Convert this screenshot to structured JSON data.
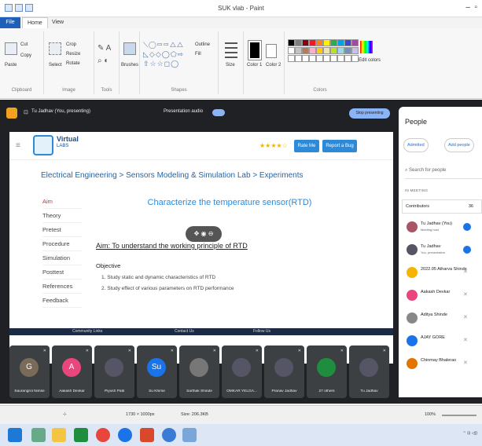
{
  "window": {
    "title": "SUK vlab - Paint"
  },
  "menu": {
    "file": "File",
    "home": "Home",
    "view": "View"
  },
  "ribbon": {
    "clipboard": {
      "paste": "Paste",
      "cut": "Cut",
      "copy": "Copy",
      "label": "Clipboard"
    },
    "image": {
      "select": "Select",
      "crop": "Crop",
      "resize": "Resize",
      "rotate": "Rotate",
      "label": "Image"
    },
    "tools": {
      "label": "Tools"
    },
    "brushes": "Brushes",
    "shapes": {
      "outline": "Outline",
      "fill": "Fill",
      "label": "Shapes"
    },
    "size": "Size",
    "color1": "Color 1",
    "color2": "Color 2",
    "colors_label": "Colors",
    "edit_colors": "Edit colors"
  },
  "meet": {
    "presenter": "Tu Jadhav (You, presenting)",
    "presentation_audio": "Presentation audio",
    "stop_button": "Stop presenting"
  },
  "vlab": {
    "logo_title": "Virtual",
    "logo_sub": "LABS",
    "stars": "★★★★☆",
    "rate_me": "Rate Me",
    "report_bug": "Report a Bug",
    "breadcrumb": "Electrical Engineering > Sensors Modeling & Simulation Lab > Experiments",
    "menu": [
      "Aim",
      "Theory",
      "Pretest",
      "Procedure",
      "Simulation",
      "Posttest",
      "References",
      "Feedback"
    ],
    "title": "Characterize the temperature sensor(RTD)",
    "aim": "Aim: To understand the working principle of RTD",
    "objective": "Objective",
    "objectives": [
      "1. Study static and dynamic characteristics of RTD",
      "2. Study effect of various parameters on RTD performance"
    ],
    "footer": [
      "Community Links",
      "Contact Us",
      "Follow Us"
    ]
  },
  "tiles": [
    {
      "name": "Saurangrol Nimse",
      "initial": "G",
      "color": "#7a6a5a"
    },
    {
      "name": "Aakash Devkar",
      "initial": "A",
      "color": "#e8467c"
    },
    {
      "name": "Piyush Patil",
      "initial": "",
      "color": "#556"
    },
    {
      "name": "Su Khirse",
      "initial": "Su",
      "color": "#1a73e8"
    },
    {
      "name": "Sarthak Shinde",
      "initial": "",
      "color": "#777"
    },
    {
      "name": "OMKAR YELGA...",
      "initial": "",
      "color": "#556"
    },
    {
      "name": "Pranav Jadhav",
      "initial": "",
      "color": "#556"
    },
    {
      "name": "27 others",
      "initial": "",
      "color": "#1e8e3e"
    },
    {
      "name": "Tu Jadhav",
      "initial": "",
      "color": "#556"
    }
  ],
  "people": {
    "title": "People",
    "admitted": "Admitted",
    "add_people": "Add people",
    "search_placeholder": "Search for people",
    "section": "IN MEETING",
    "contributors": "Contributors",
    "contributors_count": "36",
    "list": [
      {
        "name": "Tu Jadhav (You)",
        "sub": "Meeting host",
        "color": "#a56",
        "mic": "on"
      },
      {
        "name": "Tu Jadhav",
        "sub": "You, presentation",
        "color": "#556",
        "mic": "on"
      },
      {
        "name": "2022.05 Atharva Shinde",
        "sub": "",
        "color": "#f4b400",
        "mic": "off"
      },
      {
        "name": "Aakash Devkar",
        "sub": "",
        "color": "#e8467c",
        "mic": "off"
      },
      {
        "name": "Aditya Shinde",
        "sub": "",
        "color": "#888",
        "mic": "off"
      },
      {
        "name": "AJAY GORE",
        "sub": "",
        "color": "#1a73e8",
        "mic": "off"
      },
      {
        "name": "Chinmay Bhalerao",
        "sub": "",
        "color": "#e37400",
        "mic": "off"
      }
    ]
  },
  "status": {
    "dims": "1730 × 1000px",
    "size": "Size: 206.3KB",
    "zoom": "100%"
  }
}
